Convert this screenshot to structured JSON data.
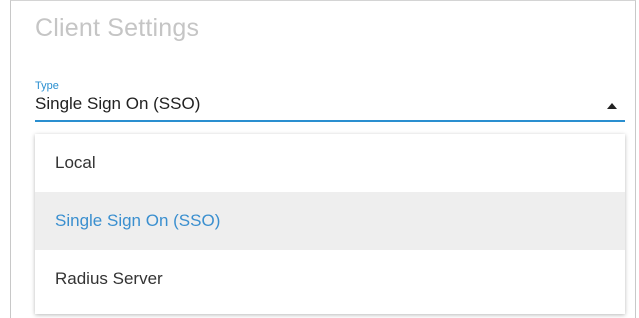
{
  "section": {
    "title": "Client Settings"
  },
  "type_field": {
    "label": "Type",
    "value": "Single Sign On (SSO)",
    "caret_icon": "caret-up-icon",
    "accent_color": "#2a8fd0"
  },
  "dropdown": {
    "options": [
      {
        "label": "Local",
        "selected": false
      },
      {
        "label": "Single Sign On (SSO)",
        "selected": true
      },
      {
        "label": "Radius Server",
        "selected": false
      }
    ],
    "selected_color": "#3a8fcf",
    "selected_background": "#eeeeee"
  }
}
